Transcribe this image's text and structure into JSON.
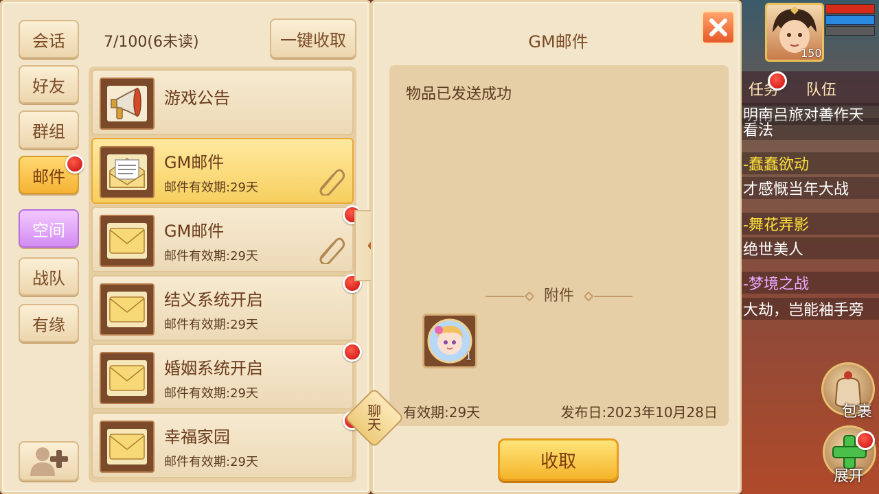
{
  "sidebar": {
    "tabs": [
      {
        "label": "会话"
      },
      {
        "label": "好友"
      },
      {
        "label": "群组"
      },
      {
        "label": "邮件"
      },
      {
        "label": "空间"
      },
      {
        "label": "战队"
      },
      {
        "label": "有缘"
      }
    ],
    "add_friend_icon": "add-friend-icon"
  },
  "mailbox": {
    "count_text": "7/100(6未读)",
    "collect_all_label": "一键收取",
    "items": [
      {
        "title": "游戏公告",
        "subtitle": "",
        "icon": "megaphone-icon",
        "unread": false,
        "attachment": false,
        "selected": false
      },
      {
        "title": "GM邮件",
        "subtitle": "邮件有效期:29天",
        "icon": "open-envelope-icon",
        "unread": false,
        "attachment": true,
        "selected": true
      },
      {
        "title": "GM邮件",
        "subtitle": "邮件有效期:29天",
        "icon": "envelope-icon",
        "unread": true,
        "attachment": true,
        "selected": false
      },
      {
        "title": "结义系统开启",
        "subtitle": "邮件有效期:29天",
        "icon": "envelope-icon",
        "unread": true,
        "attachment": false,
        "selected": false
      },
      {
        "title": "婚姻系统开启",
        "subtitle": "邮件有效期:29天",
        "icon": "envelope-icon",
        "unread": true,
        "attachment": false,
        "selected": false
      },
      {
        "title": "幸福家园",
        "subtitle": "邮件有效期:29天",
        "icon": "envelope-icon",
        "unread": true,
        "attachment": false,
        "selected": false
      }
    ]
  },
  "chat_tag_label": "聊天",
  "mail_detail": {
    "title": "GM邮件",
    "body": "物品已发送成功",
    "attachment_label": "附件",
    "attachment_count": "1",
    "validity": "有效期:29天",
    "publish_date": "发布日:2023年10月28日",
    "claim_label": "收取"
  },
  "game_hud": {
    "level": "150",
    "quest_tab": "任务",
    "team_tab": "队伍",
    "chat_lines": [
      {
        "text": "明南吕旅对善作天",
        "color": "#ffffff"
      },
      {
        "text": "看法",
        "color": "#ffffff"
      },
      {
        "text": "-蠢蠢欲动",
        "color": "#ffe23a"
      },
      {
        "text": "才感慨当年大战",
        "color": "#ffffff"
      },
      {
        "text": "-舞花弄影",
        "color": "#ffe23a"
      },
      {
        "text": "绝世美人",
        "color": "#ffffff"
      },
      {
        "text": "-梦境之战",
        "color": "#e9a8ff"
      },
      {
        "text": "大劫，岂能袖手旁",
        "color": "#ffffff"
      }
    ],
    "bag_label": "包裹",
    "expand_label": "展开"
  },
  "colors": {
    "panel_bg": "#f3e5c9",
    "selected_item": "#f7cf5f",
    "unread_dot": "#c50d0d",
    "claim_button": "#f5b42a"
  }
}
